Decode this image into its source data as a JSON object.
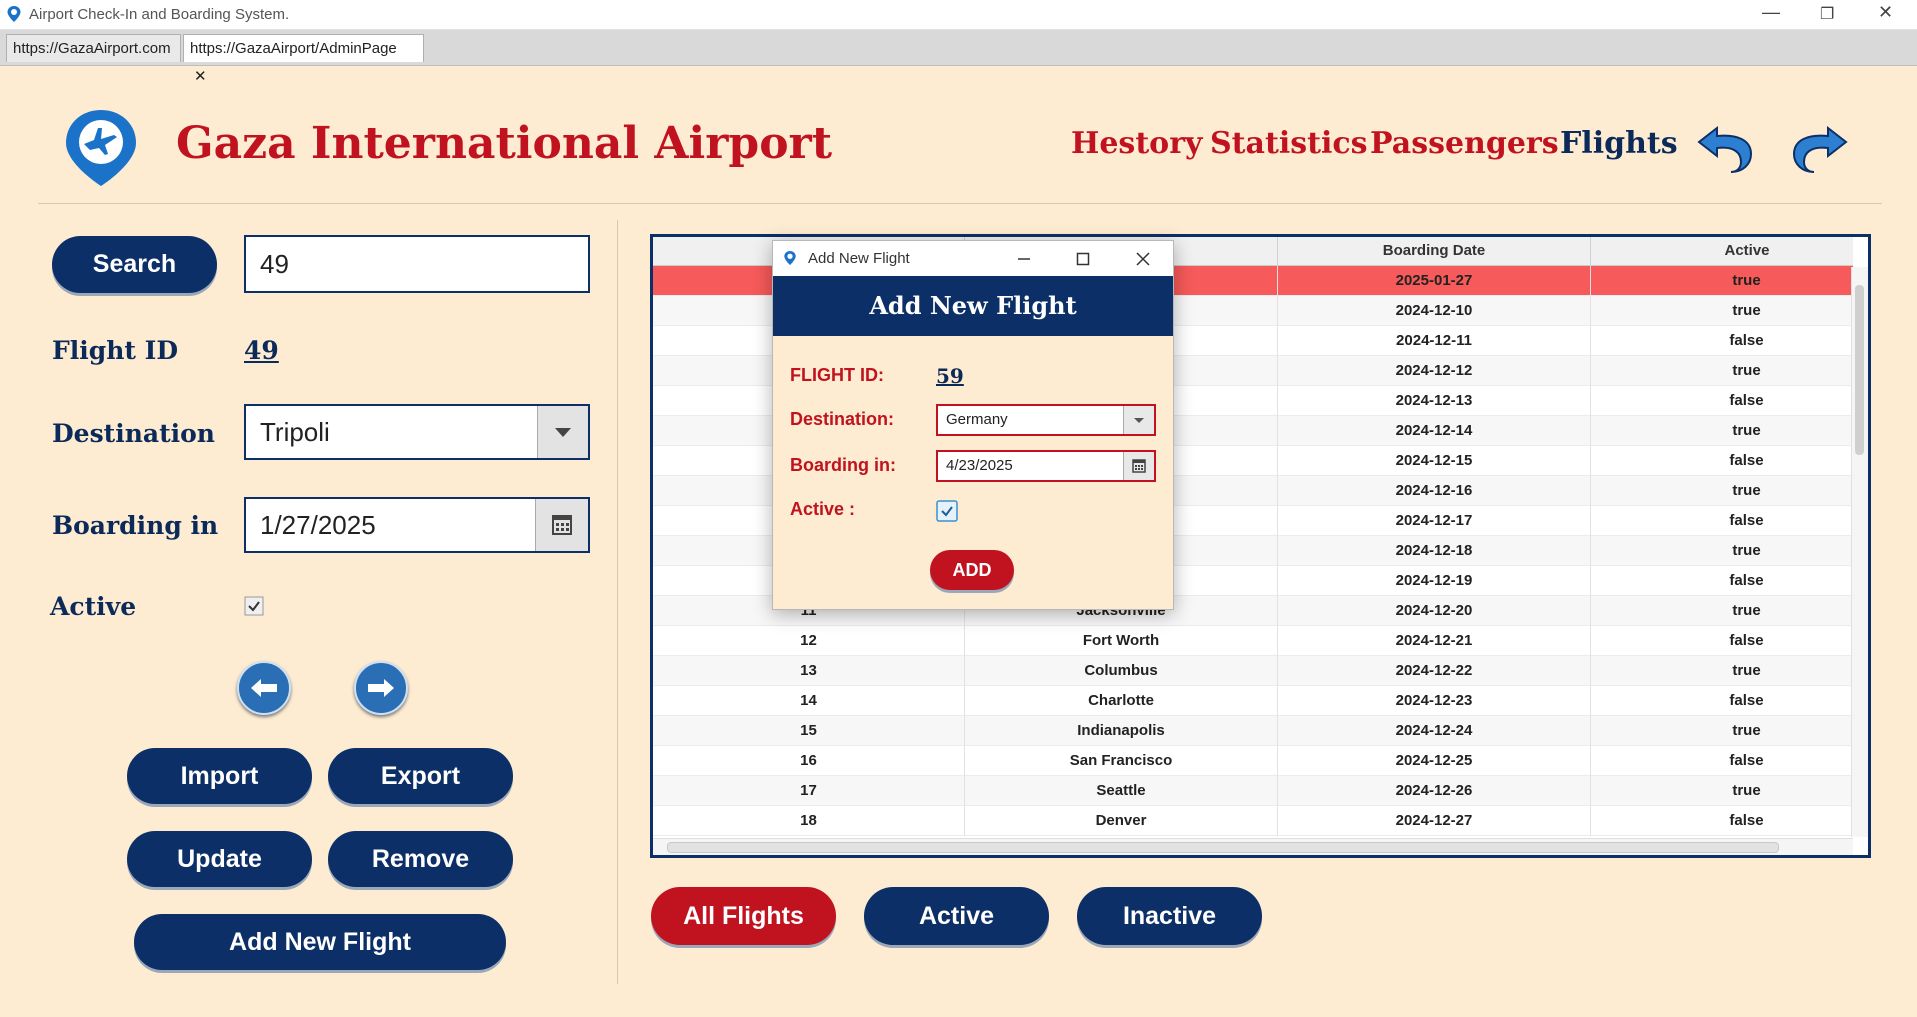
{
  "window": {
    "title": "Airport Check-In and Boarding System.",
    "controls": {
      "minimize": "—",
      "restore": "❐",
      "close": "✕"
    }
  },
  "tabs": [
    {
      "label": "https://GazaAirport.com"
    },
    {
      "label": "https://GazaAirport/AdminPage",
      "close": "✕"
    }
  ],
  "header": {
    "title": "Gaza International Airport",
    "nav": [
      "Hestory",
      "Statistics",
      "Passengers",
      "Flights"
    ]
  },
  "form": {
    "search_label": "Search",
    "search_value": "49",
    "flight_id_label": "Flight ID",
    "flight_id_value": "49",
    "destination_label": "Destination",
    "destination_value": "Tripoli",
    "boarding_label": "Boarding in",
    "boarding_value": "1/27/2025",
    "active_label": "Active",
    "active_checked": true,
    "buttons": {
      "import": "Import",
      "export": "Export",
      "update": "Update",
      "remove": "Remove",
      "add_new": "Add New Flight"
    }
  },
  "table": {
    "columns": [
      "Boarding Date",
      "Active"
    ],
    "rows_top": [
      {
        "date": "2025-01-27",
        "active": "true",
        "selected": true
      },
      {
        "date": "2024-12-10",
        "active": "true"
      },
      {
        "date": "2024-12-11",
        "active": "false"
      },
      {
        "date": "2024-12-12",
        "active": "true"
      },
      {
        "date": "2024-12-13",
        "active": "false"
      },
      {
        "date": "2024-12-14",
        "active": "true"
      },
      {
        "date": "2024-12-15",
        "active": "false"
      },
      {
        "date": "2024-12-16",
        "active": "true"
      },
      {
        "date": "2024-12-17",
        "active": "false"
      },
      {
        "date": "2024-12-18",
        "active": "true"
      },
      {
        "date": "2024-12-19",
        "active": "false"
      }
    ],
    "rows_full": [
      {
        "id": "11",
        "dest": "Jacksonville",
        "date": "2024-12-20",
        "active": "true"
      },
      {
        "id": "12",
        "dest": "Fort Worth",
        "date": "2024-12-21",
        "active": "false"
      },
      {
        "id": "13",
        "dest": "Columbus",
        "date": "2024-12-22",
        "active": "true"
      },
      {
        "id": "14",
        "dest": "Charlotte",
        "date": "2024-12-23",
        "active": "false"
      },
      {
        "id": "15",
        "dest": "Indianapolis",
        "date": "2024-12-24",
        "active": "true"
      },
      {
        "id": "16",
        "dest": "San Francisco",
        "date": "2024-12-25",
        "active": "false"
      },
      {
        "id": "17",
        "dest": "Seattle",
        "date": "2024-12-26",
        "active": "true"
      },
      {
        "id": "18",
        "dest": "Denver",
        "date": "2024-12-27",
        "active": "false"
      }
    ]
  },
  "filters": {
    "all": "All Flights",
    "active": "Active",
    "inactive": "Inactive"
  },
  "dialog": {
    "window_title": "Add New Flight",
    "header": "Add New Flight",
    "flight_id_label": "FLIGHT ID:",
    "flight_id_value": "59",
    "destination_label": "Destination:",
    "destination_value": "Germany",
    "boarding_label": "Boarding in:",
    "boarding_value": "4/23/2025",
    "active_label": "Active :",
    "active_checked": true,
    "add_button": "ADD"
  },
  "colors": {
    "navy": "#0b2f66",
    "red": "#c1121f",
    "cream": "#fdecd2",
    "selected_row": "#f65a5a"
  }
}
